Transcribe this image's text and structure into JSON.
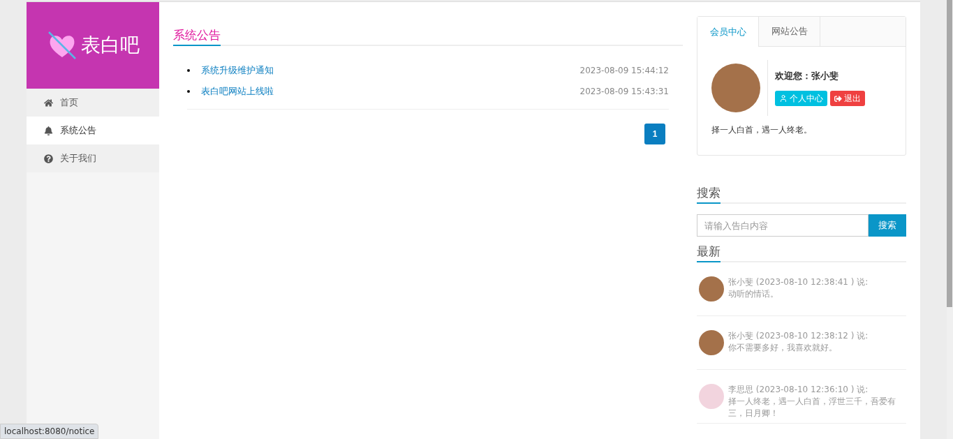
{
  "logo": {
    "text": "表白吧"
  },
  "nav": [
    {
      "label": "首页",
      "selected": false
    },
    {
      "label": "系统公告",
      "selected": true
    },
    {
      "label": "关于我们",
      "selected": false
    }
  ],
  "notices": {
    "title": "系统公告",
    "items": [
      {
        "title": "系统升级维护通知",
        "time": "2023-08-09 15:44:12"
      },
      {
        "title": "表白吧网站上线啦",
        "time": "2023-08-09 15:43:31"
      }
    ],
    "pages": [
      {
        "label": "1",
        "selected": true
      }
    ]
  },
  "member": {
    "tabs": [
      {
        "label": "会员中心",
        "selected": true
      },
      {
        "label": "网站公告",
        "selected": false
      }
    ],
    "welcome": "欢迎您：张小斐",
    "buttons": [
      {
        "label": "个人中心",
        "kind": "profile"
      },
      {
        "label": "退出",
        "kind": "logout"
      }
    ],
    "motto": "择一人白首，遇一人终老。"
  },
  "search": {
    "title": "搜索",
    "placeholder": "请输入告白内容",
    "button": "搜索"
  },
  "latest": {
    "title": "最新",
    "items": [
      {
        "header": "张小斐 (2023-08-10 12:38:41 ) 说:",
        "text": "动听的情话。"
      },
      {
        "header": "张小斐 (2023-08-10 12:38:12 ) 说:",
        "text": "你不需要多好，我喜欢就好。"
      },
      {
        "header": "李思思 (2023-08-10 12:36:10 ) 说:",
        "text": "择一人终老，遇一人白首，浮世三千，吾爱有三，日月卿！"
      }
    ]
  },
  "status_url": "localhost:8080/notice"
}
